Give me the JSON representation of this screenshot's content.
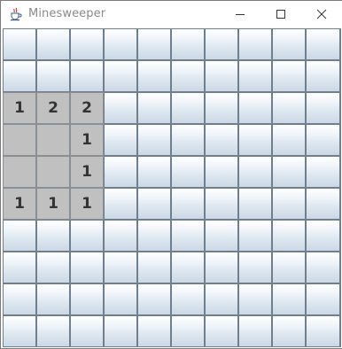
{
  "window": {
    "title": "Minesweeper",
    "app_icon": "java-cup-icon",
    "controls": [
      "minimize-icon",
      "maximize-icon",
      "close-icon"
    ]
  },
  "board": {
    "rows": 10,
    "cols": 10,
    "cells": [
      [
        "",
        "",
        "",
        "",
        "",
        "",
        "",
        "",
        "",
        ""
      ],
      [
        "",
        "",
        "",
        "",
        "",
        "",
        "",
        "",
        "",
        ""
      ],
      [
        "1",
        "2",
        "2",
        "",
        "",
        "",
        "",
        "",
        "",
        ""
      ],
      [
        "0",
        "0",
        "1",
        "",
        "",
        "",
        "",
        "",
        "",
        ""
      ],
      [
        "0",
        "0",
        "1",
        "",
        "",
        "",
        "",
        "",
        "",
        ""
      ],
      [
        "1",
        "1",
        "1",
        "",
        "",
        "",
        "",
        "",
        "",
        ""
      ],
      [
        "",
        "",
        "",
        "",
        "",
        "",
        "",
        "",
        "",
        ""
      ],
      [
        "",
        "",
        "",
        "",
        "",
        "",
        "",
        "",
        "",
        ""
      ],
      [
        "",
        "",
        "",
        "",
        "",
        "",
        "",
        "",
        "",
        ""
      ],
      [
        "",
        "",
        "",
        "",
        "",
        "",
        "",
        "",
        "",
        ""
      ]
    ],
    "legend": {
      "": "hidden",
      "0": "revealed-empty",
      "1-8": "revealed-number"
    }
  }
}
